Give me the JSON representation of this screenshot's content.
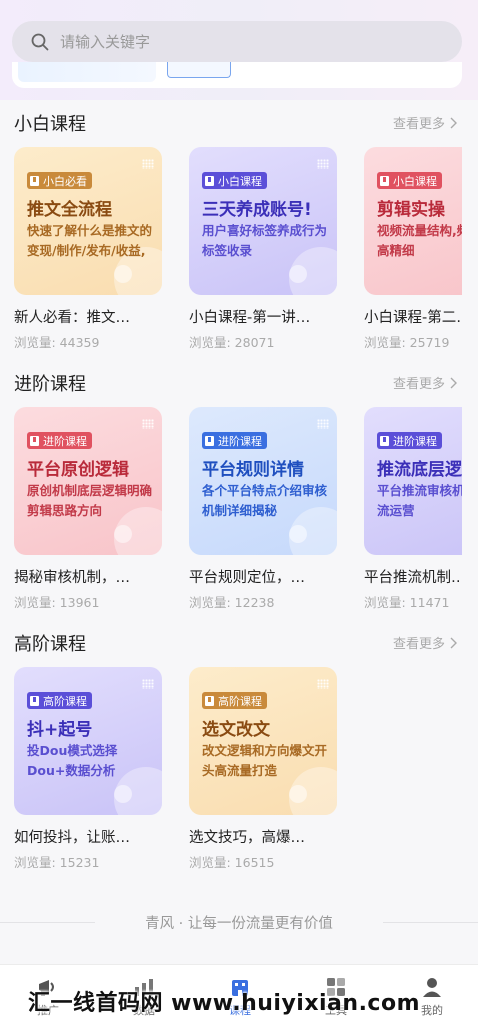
{
  "search": {
    "placeholder": "请输入关键字"
  },
  "sections": [
    {
      "title": "小白课程",
      "see_more": "查看更多",
      "cards": [
        {
          "badge": "小白必看",
          "headline": "推文全流程",
          "sub": "快速了解什么是推文的变现/制作/发布/收益,",
          "title": "新人必看：推文…",
          "views": "浏览量: 44359",
          "theme": "yellow"
        },
        {
          "badge": "小白课程",
          "headline": "三天养成账号!",
          "sub": "用户喜好标签养成行为标签收录",
          "title": "小白课程-第一讲…",
          "views": "浏览量: 28071",
          "theme": "purple"
        },
        {
          "badge": "小白课程",
          "headline": "剪辑实操",
          "sub": "视频流量结构,频率来源/高精细",
          "title": "小白课程-第二…",
          "views": "浏览量: 25719",
          "theme": "pink"
        }
      ]
    },
    {
      "title": "进阶课程",
      "see_more": "查看更多",
      "cards": [
        {
          "badge": "进阶课程",
          "headline": "平台原创逻辑",
          "sub": "原创机制底层逻辑明确剪辑思路方向",
          "title": "揭秘审核机制，…",
          "views": "浏览量: 13961",
          "theme": "pink"
        },
        {
          "badge": "进阶课程",
          "headline": "平台规则详情",
          "sub": "各个平台特点介绍审核机制详细揭秘",
          "title": "平台规则定位，…",
          "views": "浏览量: 12238",
          "theme": "blue"
        },
        {
          "badge": "进阶课程",
          "headline": "推流底层逻",
          "sub": "平台推流审核机账号推流运营",
          "title": "平台推流机制…",
          "views": "浏览量: 11471",
          "theme": "purple"
        }
      ]
    },
    {
      "title": "高阶课程",
      "see_more": "查看更多",
      "cards": [
        {
          "badge": "高阶课程",
          "headline": "抖+起号",
          "sub": "投Dou模式选择Dou+数据分析",
          "title": "如何投抖，让账…",
          "views": "浏览量: 15231",
          "theme": "purple"
        },
        {
          "badge": "高阶课程",
          "headline": "选文改文",
          "sub": "改文逻辑和方向爆文开头高流量打造",
          "title": "选文技巧，高爆…",
          "views": "浏览量: 16515",
          "theme": "yellow"
        }
      ]
    }
  ],
  "footer": {
    "slogan": "青风 · 让每一份流量更有价值"
  },
  "tabbar": {
    "tabs": [
      {
        "label": "推广",
        "icon": "megaphone-icon"
      },
      {
        "label": "数据",
        "icon": "chart-icon"
      },
      {
        "label": "课程",
        "icon": "building-icon"
      },
      {
        "label": "工具",
        "icon": "apps-icon"
      },
      {
        "label": "我的",
        "icon": "user-icon"
      }
    ]
  },
  "watermark": "汇一线首码网 www.huiyixian.com",
  "colors": {
    "accent": "#3a6fe0",
    "yellow_bg": "#fbe7c7",
    "purple_bg": "#d9d5fb",
    "pink_bg": "#fbd3d6",
    "blue_bg": "#d4e3fc"
  }
}
